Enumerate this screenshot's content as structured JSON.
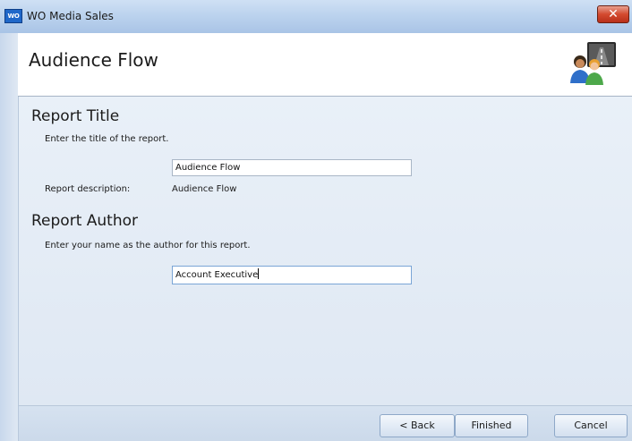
{
  "window": {
    "title": "WO Media Sales",
    "app_icon_text": "WO",
    "close_glyph": "✕"
  },
  "header": {
    "title": "Audience Flow",
    "icon": "users-road-icon"
  },
  "report_title_section": {
    "heading": "Report Title",
    "hint": "Enter the title of the report.",
    "title_value": "Audience Flow",
    "description_label": "Report description:",
    "description_value": "Audience Flow"
  },
  "report_author_section": {
    "heading": "Report Author",
    "hint": "Enter your name as the author for this report.",
    "author_value": "Account Executive"
  },
  "footer": {
    "back_label": "< Back",
    "finished_label": "Finished",
    "cancel_label": "Cancel"
  },
  "colors": {
    "title_bar": "#bcd3ee",
    "close_button": "#d34a2f",
    "content_bg": "#dfe8f3"
  }
}
